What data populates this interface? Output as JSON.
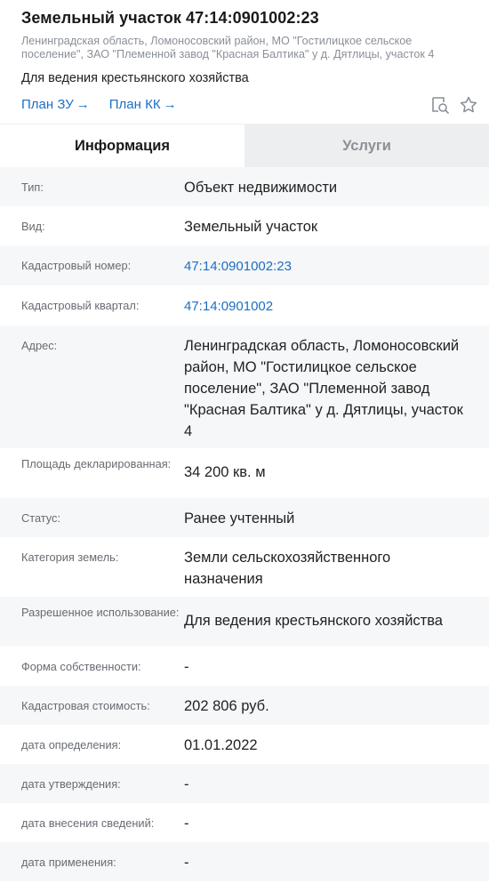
{
  "header": {
    "title": "Земельный участок 47:14:0901002:23",
    "address": "Ленинградская область, Ломоносовский район, МО \"Гостилицкое сельское поселение\", ЗАО \"Племенной завод \"Красная Балтика\" у д. Дятлицы, участок 4",
    "purpose": "Для ведения крестьянского хозяйства",
    "plan_zu": "План ЗУ",
    "plan_kk": "План КК",
    "arrow": "→"
  },
  "tabs": [
    {
      "label": "Информация",
      "active": true
    },
    {
      "label": "Услуги",
      "active": false
    }
  ],
  "rows": [
    {
      "label": "Тип:",
      "value": "Объект недвижимости"
    },
    {
      "label": "Вид:",
      "value": "Земельный участок"
    },
    {
      "label": "Кадастровый номер:",
      "value": "47:14:0901002:23"
    },
    {
      "label": "Кадастровый квартал:",
      "value": "47:14:0901002"
    },
    {
      "label": "Адрес:",
      "value": "Ленинградская область, Ломоносовский район, МО \"Гостилицкое сельское поселение\", ЗАО \"Племенной завод \"Красная Балтика\" у д. Дятлицы, участок 4"
    },
    {
      "label": "Площадь декларированная:",
      "value": "34 200 кв. м"
    },
    {
      "label": "Статус:",
      "value": "Ранее учтенный"
    },
    {
      "label": "Категория земель:",
      "value": "Земли сельскохозяйственного назначения"
    },
    {
      "label": "Разрешенное использование:",
      "value": "Для ведения крестьянского хозяйства"
    },
    {
      "label": "Форма собственности:",
      "value": "-"
    },
    {
      "label": "Кадастровая стоимость:",
      "value": "202 806 руб."
    },
    {
      "label": "дата определения:",
      "value": "01.01.2022"
    },
    {
      "label": "дата утверждения:",
      "value": "-"
    },
    {
      "label": "дата внесения сведений:",
      "value": "-"
    },
    {
      "label": "дата применения:",
      "value": "-"
    }
  ],
  "icons": {
    "search_map": "map-search-icon",
    "favorite": "star-icon"
  },
  "colors": {
    "link": "#1b6fc4",
    "inactive_tab_bg": "#eceef0",
    "stripe": "#f6f7f8"
  }
}
